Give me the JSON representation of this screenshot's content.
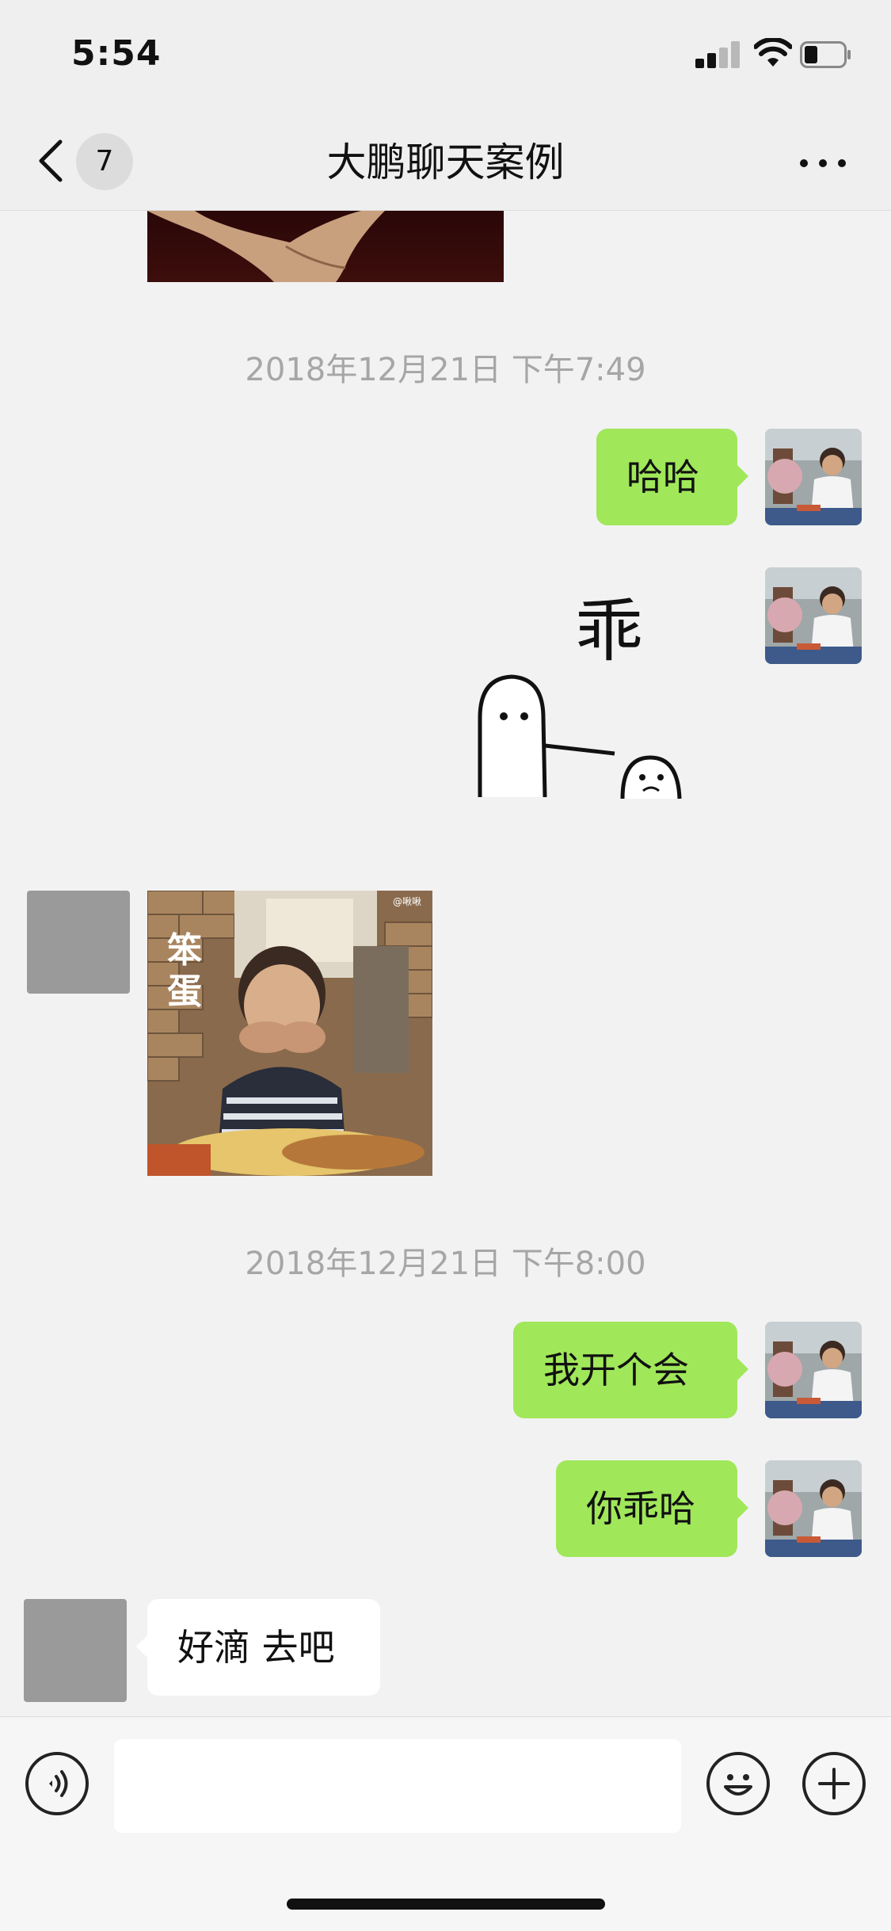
{
  "status_bar": {
    "time": "5:54"
  },
  "nav": {
    "back_badge": "7",
    "title": "大鹏聊天案例"
  },
  "chat": {
    "timestamp_1": "2018年12月21日 下午7:49",
    "msg_haha": "哈哈",
    "sticker_text": "乖",
    "photo_caption": "笨蛋",
    "photo_watermark": "@啾啾",
    "timestamp_2": "2018年12月21日 下午8:00",
    "msg_meeting": "我开个会",
    "msg_be_good": "你乖哈",
    "msg_reply": "好滴 去吧"
  },
  "colors": {
    "my_bubble": "#a0e75a",
    "other_bubble": "#ffffff",
    "background": "#f2f2f2",
    "timestamp_text": "#a6a6a6"
  },
  "icons": {
    "back": "chevron-left-icon",
    "more": "more-dots-icon",
    "voice": "voice-icon",
    "emoji": "emoji-icon",
    "add": "plus-icon"
  }
}
